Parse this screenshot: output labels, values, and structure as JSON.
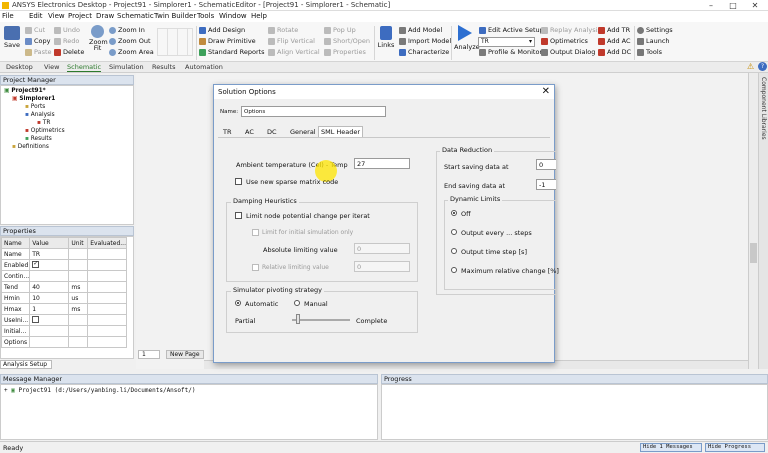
{
  "window": {
    "title": "ANSYS Electronics Desktop - Project91 - Simplorer1 - SchematicEditor - [Project91 - Simplorer1 - Schematic]",
    "min": "–",
    "max": "□",
    "close": "✕"
  },
  "menu": [
    "File",
    "Edit",
    "View",
    "Project",
    "Draw",
    "Schematic",
    "Twin Builder",
    "Tools",
    "Window",
    "Help"
  ],
  "ribbon": {
    "save": "Save",
    "cut": "Cut",
    "copy": "Copy",
    "paste": "Paste",
    "undo": "Undo",
    "redo": "Redo",
    "delete": "Delete",
    "zoom_fit": "Zoom Fit",
    "zoom_in": "Zoom In",
    "zoom_out": "Zoom Out",
    "zoom_area": "Zoom Area",
    "add_design": "Add Design",
    "draw_primitive": "Draw Primitive",
    "standard_reports": "Standard Reports",
    "rotate": "Rotate",
    "flip_vertical": "Flip Vertical",
    "align_vertical": "Align Vertical",
    "pop_up": "Pop Up",
    "short_open": "Short/Open",
    "properties": "Properties",
    "links": "Links",
    "add_model": "Add Model",
    "import_model": "Import Model",
    "characterize": "Characterize",
    "analyze": "Analyze",
    "edit_active_setup": "Edit Active Setup",
    "setup_select": "TR",
    "profile_monitor": "Profile & Monitor",
    "replay_analysis": "Replay Analysis",
    "optimetrics": "Optimetrics",
    "output_dialog": "Output Dialog",
    "add_tr": "Add TR",
    "add_ac": "Add AC",
    "add_dc": "Add DC",
    "settings": "Settings",
    "launch": "Launch",
    "tools": "Tools"
  },
  "tabs": [
    "Desktop",
    "View",
    "Schematic",
    "Simulation",
    "Results",
    "Automation"
  ],
  "project_manager": {
    "title": "Project Manager",
    "tree": [
      "Project91*",
      "Simplorer1",
      "Ports",
      "Analysis",
      "TR",
      "Optimetrics",
      "Results",
      "Definitions"
    ]
  },
  "properties": {
    "title": "Properties",
    "headers": [
      "Name",
      "Value",
      "Unit",
      "Evaluated..."
    ],
    "rows": [
      {
        "name": "Name",
        "value": "TR",
        "unit": ""
      },
      {
        "name": "Enabled",
        "value": "",
        "unit": ""
      },
      {
        "name": "Contin...",
        "value": "",
        "unit": ""
      },
      {
        "name": "Tend",
        "value": "40",
        "unit": "ms"
      },
      {
        "name": "Hmin",
        "value": "10",
        "unit": "us"
      },
      {
        "name": "Hmax",
        "value": "1",
        "unit": "ms"
      },
      {
        "name": "UseIni...",
        "value": "",
        "unit": ""
      },
      {
        "name": "Initial...",
        "value": "",
        "unit": ""
      },
      {
        "name": "Options",
        "value": "",
        "unit": ""
      }
    ],
    "analysis_setup_tab": "Analysis Setup"
  },
  "canvas": {
    "page_num": "1",
    "new_page": "New Page"
  },
  "right_strip": "Component Libraries",
  "dialog": {
    "title": "Solution Options",
    "name_label": "Name:",
    "name_value": "Options",
    "tabs": [
      "TR",
      "AC",
      "DC",
      "General",
      "SML Header"
    ],
    "ambient_label": "Ambient temperature (Cel) - Temp",
    "ambient_value": "27",
    "sparse_label": "Use new sparse matrix code",
    "damping_title": "Damping Heuristics",
    "limit_node_label": "Limit node potential change per iteration",
    "limit_initial_label": "Limit for initial simulation only",
    "abs_limit_label": "Absolute limiting value",
    "abs_limit_value": "0",
    "rel_limit_label": "Relative limiting value",
    "rel_limit_value": "0",
    "pivot_title": "Simulator pivoting strategy",
    "automatic": "Automatic",
    "manual": "Manual",
    "partial": "Partial",
    "complete": "Complete",
    "data_reduction_title": "Data Reduction",
    "start_saving_label": "Start saving data at",
    "start_saving_value": "0",
    "end_saving_label": "End saving data at",
    "end_saving_value": "-1",
    "dynamic_limits_title": "Dynamic Limits",
    "dynamic_options": [
      "Off",
      "Output every ... steps",
      "Output time step [s]",
      "Maximum relative change [%]"
    ]
  },
  "message_manager": {
    "title": "Message Manager",
    "item": "Project91 (d:/Users/yanbing.li/Documents/Ansoft/)"
  },
  "progress": {
    "title": "Progress"
  },
  "status": {
    "ready": "Ready",
    "hide_messages": "Hide 1 Messages",
    "hide_progress": "Hide Progress"
  }
}
